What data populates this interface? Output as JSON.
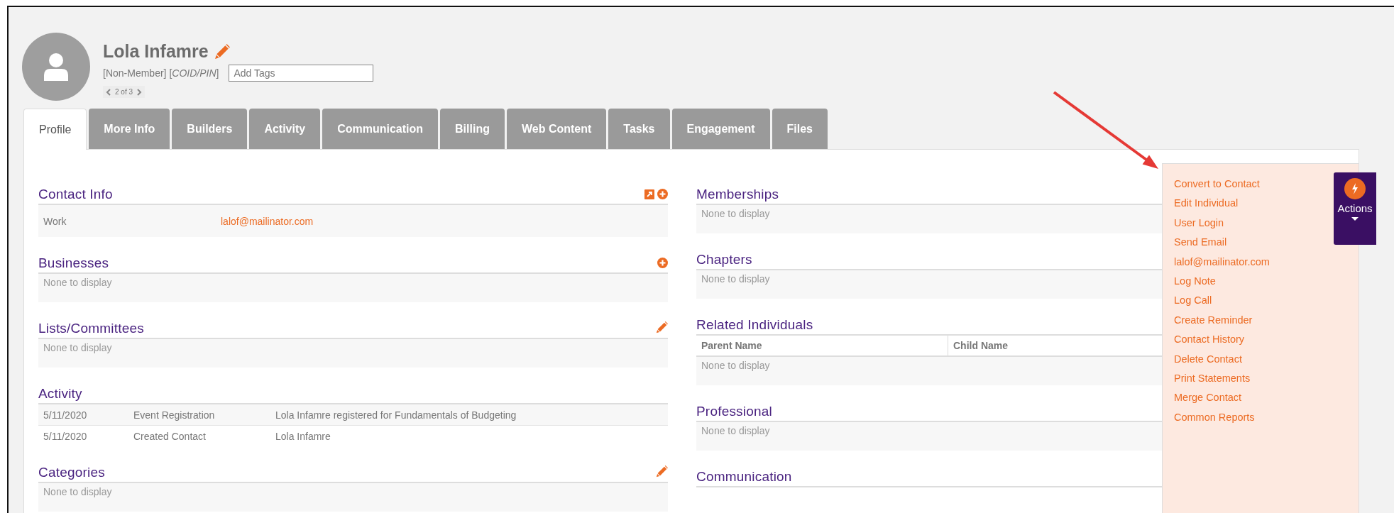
{
  "header": {
    "name": "Lola Infamre",
    "member_type": "[Non-Member]",
    "coid": "[*COID/PIN*]",
    "tags_placeholder": "Add Tags",
    "pager": "2 of 3"
  },
  "tabs": [
    {
      "label": "Profile",
      "selected": true
    },
    {
      "label": "More Info",
      "selected": false
    },
    {
      "label": "Builders",
      "selected": false
    },
    {
      "label": "Activity",
      "selected": false
    },
    {
      "label": "Communication",
      "selected": false
    },
    {
      "label": "Billing",
      "selected": false
    },
    {
      "label": "Web Content",
      "selected": false
    },
    {
      "label": "Tasks",
      "selected": false
    },
    {
      "label": "Engagement",
      "selected": false
    },
    {
      "label": "Files",
      "selected": false
    }
  ],
  "left_sections": [
    {
      "title": "Contact Info",
      "kind": "fields",
      "icons": [
        {
          "kind": "expand"
        },
        {
          "kind": "add"
        }
      ],
      "rows": [
        {
          "label": "Work",
          "value": "lalof@mailinator.com"
        }
      ]
    },
    {
      "title": "Businesses",
      "kind": "empty",
      "icons": [
        {
          "kind": "add"
        }
      ],
      "empty_text": "None to display"
    },
    {
      "title": "Lists/Committees",
      "kind": "empty",
      "icons": [
        {
          "kind": "edit"
        }
      ],
      "empty_text": "None to display"
    },
    {
      "title": "Activity",
      "kind": "list",
      "rows": [
        [
          "5/11/2020",
          "Event Registration",
          "Lola Infamre registered for Fundamentals of Budgeting"
        ],
        [
          "5/11/2020",
          "Created Contact",
          "Lola Infamre"
        ]
      ]
    },
    {
      "title": "Categories",
      "kind": "empty",
      "icons": [
        {
          "kind": "edit"
        }
      ],
      "empty_text": "None to display"
    }
  ],
  "right_sections": [
    {
      "title": "Memberships",
      "kind": "empty",
      "empty_text": "None to display"
    },
    {
      "title": "Chapters",
      "kind": "empty",
      "empty_text": "None to display"
    },
    {
      "title": "Related Individuals",
      "kind": "table",
      "columns": [
        "Parent Name",
        "Child Name"
      ],
      "empty_text": "None to display"
    },
    {
      "title": "Professional",
      "kind": "empty",
      "empty_text": "None to display"
    },
    {
      "title": "Communication",
      "kind": "title_only"
    }
  ],
  "actions_menu": {
    "items": [
      "Convert to Contact",
      "Edit Individual",
      "User Login",
      "Send Email",
      "lalof@mailinator.com",
      "Log Note",
      "Log Call",
      "Create Reminder",
      "Contact History",
      "Delete Contact",
      "Print Statements",
      "Merge Contact",
      "Common Reports"
    ]
  },
  "actions_button": {
    "label": "Actions"
  }
}
